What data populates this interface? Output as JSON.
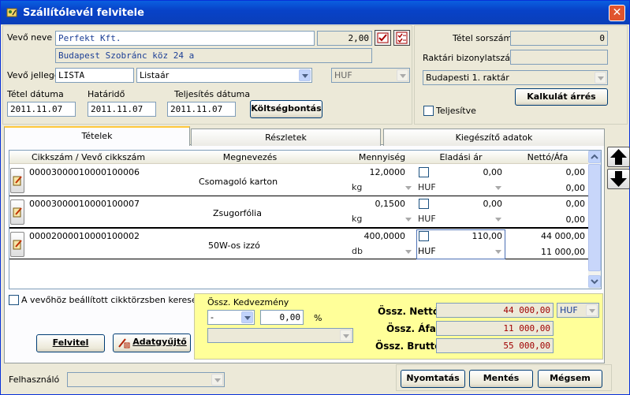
{
  "window": {
    "title": "Szállítólevél felvitele",
    "close": "✕"
  },
  "header": {
    "vevo_neve_label": "Vevő neve",
    "vevo_neve": "Perfekt Kft.",
    "vevo_szam": "2,00",
    "cim": "Budapest Szobránc köz 24 a",
    "vevo_jellege_label": "Vevő jellege",
    "vevo_jellege": "LISTA",
    "arlista": "Listaár",
    "penznem": "HUF",
    "tetel_datuma_label": "Tétel dátuma",
    "tetel_datuma": "2011.11.07",
    "hatarido_label": "Határidő",
    "hatarido": "2011.11.07",
    "teljesites_label": "Teljesítés dátuma",
    "teljesites": "2011.11.07",
    "koltsegbontas": "Költségbontás"
  },
  "right_panel": {
    "tetel_sorszam_label": "Tétel sorszám:",
    "tetel_sorszam": "0",
    "raktari_label": "Raktári bizonylatszám:",
    "raktari": "",
    "raktar": "Budapesti 1. raktár",
    "kalkulat": "Kalkulát árrés",
    "teljesitve": "Teljesítve"
  },
  "tabs": [
    "Tételek",
    "Részletek",
    "Kiegészítő adatok"
  ],
  "grid": {
    "columns": [
      "Cikkszám / Vevő cikkszám",
      "Megnevezés",
      "Mennyiség",
      "Eladási ár",
      "Nettó/Áfa"
    ],
    "rows": [
      {
        "cikkszam": "0000300001000010000 6",
        "cikk": "00003000010000100006",
        "nev": "Csomagoló karton",
        "menny": "12,0000",
        "egyseg": "kg",
        "ar": "0,00",
        "penznem": "HUF",
        "netto": "0,00",
        "afa": "0,00"
      },
      {
        "cikk": "00003000010000100007",
        "nev": "Zsugorfólia",
        "menny": "0,1500",
        "egyseg": "kg",
        "ar": "0,00",
        "penznem": "HUF",
        "netto": "0,00",
        "afa": "0,00"
      },
      {
        "cikk": "00002000010000100002",
        "nev": "50W-os izzó",
        "menny": "400,0000",
        "egyseg": "db",
        "ar": "110,00",
        "penznem": "HUF",
        "netto": "44 000,00",
        "afa": "11 000,00"
      }
    ]
  },
  "bottom": {
    "kereses": "A vevőhöz beállított cikktörzsben keresés",
    "felvitel": "Felvitel",
    "adatgyujto": "Adatgyűjtő",
    "kedvezmeny_label": "Össz. Kedvezmény",
    "kedvezmeny_mod": "-",
    "kedvezmeny": "0,00",
    "szazalek": "%",
    "netto_label": "Össz. Nettó",
    "netto": "44 000,00",
    "netto_penznem": "HUF",
    "afa_label": "Össz. Áfa",
    "afa": "11 000,00",
    "brutto_label": "Össz. Bruttó",
    "brutto": "55 000,00",
    "felhasznalo_label": "Felhasználó",
    "felhasznalo": "",
    "nyomtatas": "Nyomtatás",
    "mentes": "Mentés",
    "megsem": "Mégsem"
  },
  "colors": {
    "title": "#0842c8",
    "yellow": "#ffff99",
    "total_text": "#a00000"
  }
}
